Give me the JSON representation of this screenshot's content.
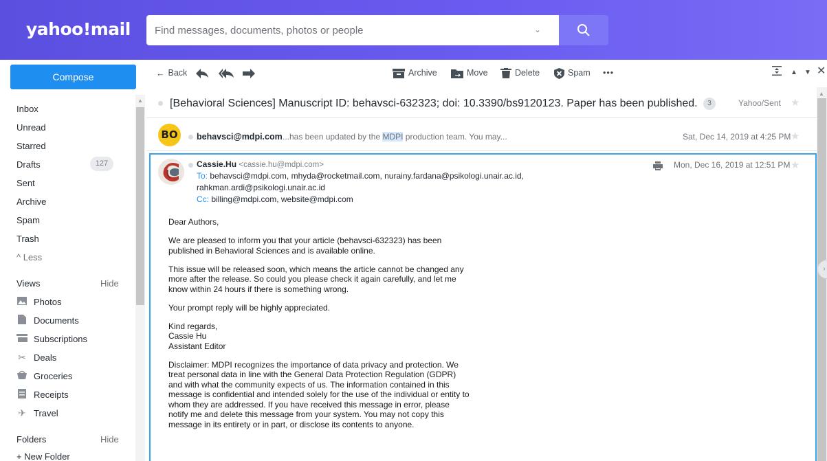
{
  "header": {
    "logo": "yahoo!mail",
    "search_placeholder": "Find messages, documents, photos or people",
    "brand_color": "#6a5cf0"
  },
  "sidebar": {
    "compose": "Compose",
    "folders": [
      {
        "label": "Inbox"
      },
      {
        "label": "Unread"
      },
      {
        "label": "Starred"
      },
      {
        "label": "Drafts",
        "badge": "127"
      },
      {
        "label": "Sent"
      },
      {
        "label": "Archive"
      },
      {
        "label": "Spam"
      },
      {
        "label": "Trash"
      }
    ],
    "less": "^ Less",
    "views_title": "Views",
    "views_hide": "Hide",
    "views": [
      {
        "label": "Photos",
        "icon": "photos-icon"
      },
      {
        "label": "Documents",
        "icon": "documents-icon"
      },
      {
        "label": "Subscriptions",
        "icon": "subscriptions-icon"
      },
      {
        "label": "Deals",
        "icon": "deals-icon"
      },
      {
        "label": "Groceries",
        "icon": "groceries-icon"
      },
      {
        "label": "Receipts",
        "icon": "receipts-icon"
      },
      {
        "label": "Travel",
        "icon": "travel-icon"
      }
    ],
    "folders_title": "Folders",
    "folders_hide": "Hide",
    "new_folder": "+ New Folder"
  },
  "toolbar": {
    "back": "Back",
    "archive": "Archive",
    "move": "Move",
    "delete": "Delete",
    "spam": "Spam",
    "more": "•••"
  },
  "thread": {
    "subject": "[Behavioral Sciences] Manuscript ID: behavsci-632323; doi: 10.3390/bs9120123. Paper has been published.",
    "count": "3",
    "folder": "Yahoo/Sent",
    "collapsed": {
      "avatar": "BO",
      "from": "behavsci@mdpi.com",
      "snippet_pre": "...has been updated by the ",
      "snippet_hl": "MDPI",
      "snippet_post": " production team. You may...",
      "date": "Sat, Dec 14, 2019 at 4:25 PM"
    },
    "open": {
      "name": "Cassie.Hu",
      "email": "<cassie.hu@mdpi.com>",
      "to_label": "To:",
      "to_line1": "behavsci@mdpi.com,  mhyda@rocketmail.com,  nurainy.fardana@psikologi.unair.ac.id,",
      "to_line2": "rahkman.ardi@psikologi.unair.ac.id",
      "cc_label": "Cc:",
      "cc": "billing@mdpi.com,  website@mdpi.com",
      "date": "Mon, Dec 16, 2019 at 12:51 PM",
      "body": {
        "greeting": "Dear Authors,",
        "p1": "We are pleased to inform you that your article (behavsci-632323) has been published in Behavioral Sciences and is available online.",
        "p2": "This issue will be released soon, which means the article cannot be changed any more after the release. So could you please check it again carefully, and let me know within 24 hours if there is something wrong.",
        "p3": "Your prompt reply will be highly appreciated.",
        "sig1": "Kind regards,",
        "sig2": "Cassie Hu",
        "sig3": "Assistant Editor",
        "disclaimer": "Disclaimer: MDPI recognizes the importance of data privacy and protection. We treat personal data in line with the General Data Protection Regulation (GDPR) and with what the community expects of us. The information contained in this message is confidential and intended solely for the use of the individual or entity to whom they are addressed. If you have received this message in error, please notify me and delete this message from your system. You may not copy this message in its entirety or in part, or disclose its contents to anyone."
      }
    }
  }
}
